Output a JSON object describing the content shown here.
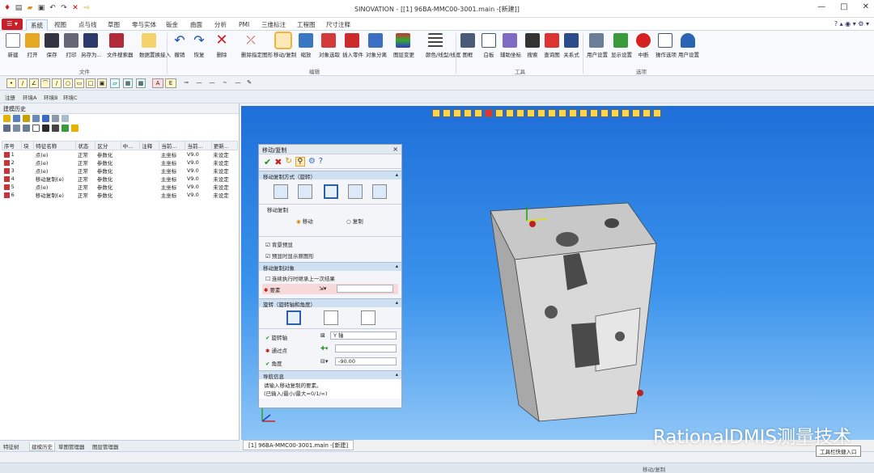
{
  "title_bar": {
    "title": "SINOVATION - [[1] 96BA-MMC00-3001.main -[新建]]",
    "controls": [
      "—",
      "□",
      "✕"
    ]
  },
  "menu": {
    "app_button": "☰ ▾",
    "tabs": [
      "系统",
      "视图",
      "点与线",
      "草图",
      "零与实体",
      "钣金",
      "曲面",
      "分析",
      "PMI",
      "三维标注",
      "工程图",
      "尺寸注释"
    ],
    "active": "系统",
    "right_icons": "? ▴ ◉ ▾ ⚙ ▾"
  },
  "ribbon": {
    "buttons": [
      "新建",
      "打开",
      "保存",
      "打印",
      "另存为...",
      "文件搜索器",
      "数据置换接入",
      "撤销",
      "恢复",
      "删除",
      "删除指定图形",
      "移动/复制",
      "缩放",
      "对象选取",
      "插入零件",
      "对象分离",
      "图层变更",
      "颜色/线型/线宽",
      "图框",
      "白板",
      "辅助坐标",
      "搜索",
      "查询图",
      "关系式",
      "用户设置",
      "显示设置",
      "中断",
      "操作选项",
      "用户设置"
    ],
    "groups": [
      "文件",
      "编辑",
      "工具",
      "选项"
    ]
  },
  "env_tabs": [
    "注册",
    "环境A",
    "环境B",
    "环境C"
  ],
  "left_panel": {
    "title": "建模历史",
    "columns": [
      "序号",
      "块",
      "特征名称",
      "状态",
      "区分",
      "中...",
      "注释",
      "当前...",
      "当前...",
      "更新..."
    ],
    "rows": [
      {
        "n": "1",
        "name": "点(e)",
        "state": "正常",
        "type": "参数化",
        "cur": "主坐标",
        "ver": "V9.0",
        "upd": "未设定"
      },
      {
        "n": "2",
        "name": "点(e)",
        "state": "正常",
        "type": "参数化",
        "cur": "主坐标",
        "ver": "V9.0",
        "upd": "未设定"
      },
      {
        "n": "3",
        "name": "点(e)",
        "state": "正常",
        "type": "参数化",
        "cur": "主坐标",
        "ver": "V9.0",
        "upd": "未设定"
      },
      {
        "n": "4",
        "name": "移动复制(e)",
        "state": "正常",
        "type": "参数化",
        "cur": "主坐标",
        "ver": "V9.0",
        "upd": "未设定"
      },
      {
        "n": "5",
        "name": "点(e)",
        "state": "正常",
        "type": "参数化",
        "cur": "主坐标",
        "ver": "V9.0",
        "upd": "未设定"
      },
      {
        "n": "6",
        "name": "移动复制(e)",
        "state": "正常",
        "type": "参数化",
        "cur": "主坐标",
        "ver": "V9.0",
        "upd": "未设定"
      }
    ],
    "bottom_tabs": [
      "特征树",
      "建模历史",
      "草图管理器",
      "图层管理器"
    ],
    "active_bottom": "建模历史"
  },
  "dialog": {
    "title": "移动/复制",
    "sec1": "移动复制方式（旋转）",
    "sub_move": "移动复制",
    "opt_move": "移动",
    "opt_copy": "复制",
    "cb_preview": "背景预显",
    "cb_show": "预显时显示原图形",
    "sec2": "移动复制对象",
    "cb_continue": "连续执行时继承上一次结果",
    "elem_label": "要素",
    "sec3": "旋转（旋转轴和角度）",
    "axis_label": "旋转轴",
    "axis_value": "Y 轴",
    "point_label": "通过点",
    "angle_label": "角度",
    "angle_value": "-90.00",
    "sec4": "导航信息",
    "nav_line1": "请输入移动复制的要素。",
    "nav_line2": "(已输入/最小/最大=0/1/∞)"
  },
  "viewport": {
    "file_tab": "[1] 96BA-MMC00-3001.main -[新建]"
  },
  "status": {
    "center": "移动/复制",
    "tooltip": "工具栏快捷入口"
  },
  "watermark": "RationalDMIS测量技术"
}
